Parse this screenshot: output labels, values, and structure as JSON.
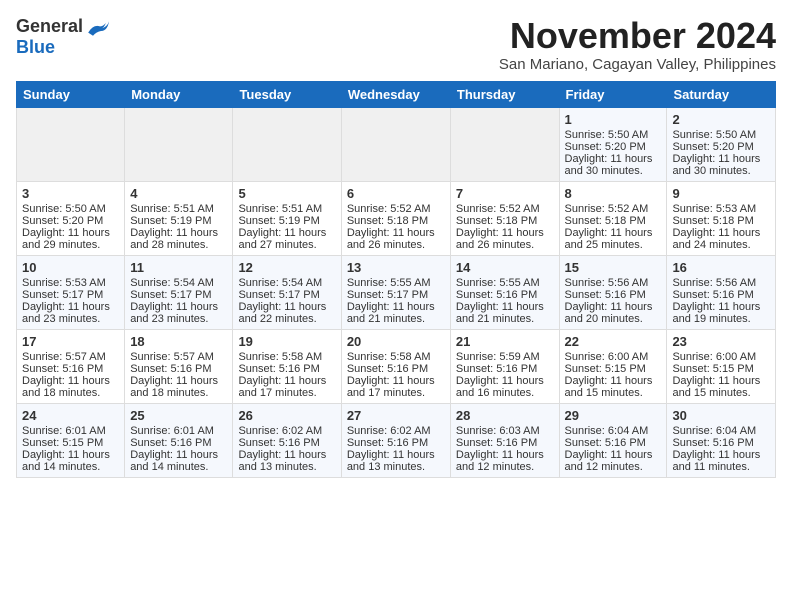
{
  "logo": {
    "general": "General",
    "blue": "Blue"
  },
  "title": "November 2024",
  "location": "San Mariano, Cagayan Valley, Philippines",
  "days_of_week": [
    "Sunday",
    "Monday",
    "Tuesday",
    "Wednesday",
    "Thursday",
    "Friday",
    "Saturday"
  ],
  "weeks": [
    [
      {
        "day": "",
        "info": "",
        "empty": true
      },
      {
        "day": "",
        "info": "",
        "empty": true
      },
      {
        "day": "",
        "info": "",
        "empty": true
      },
      {
        "day": "",
        "info": "",
        "empty": true
      },
      {
        "day": "",
        "info": "",
        "empty": true
      },
      {
        "day": "1",
        "sunrise": "Sunrise: 5:50 AM",
        "sunset": "Sunset: 5:20 PM",
        "daylight": "Daylight: 11 hours and 30 minutes."
      },
      {
        "day": "2",
        "sunrise": "Sunrise: 5:50 AM",
        "sunset": "Sunset: 5:20 PM",
        "daylight": "Daylight: 11 hours and 30 minutes."
      }
    ],
    [
      {
        "day": "3",
        "sunrise": "Sunrise: 5:50 AM",
        "sunset": "Sunset: 5:20 PM",
        "daylight": "Daylight: 11 hours and 29 minutes."
      },
      {
        "day": "4",
        "sunrise": "Sunrise: 5:51 AM",
        "sunset": "Sunset: 5:19 PM",
        "daylight": "Daylight: 11 hours and 28 minutes."
      },
      {
        "day": "5",
        "sunrise": "Sunrise: 5:51 AM",
        "sunset": "Sunset: 5:19 PM",
        "daylight": "Daylight: 11 hours and 27 minutes."
      },
      {
        "day": "6",
        "sunrise": "Sunrise: 5:52 AM",
        "sunset": "Sunset: 5:18 PM",
        "daylight": "Daylight: 11 hours and 26 minutes."
      },
      {
        "day": "7",
        "sunrise": "Sunrise: 5:52 AM",
        "sunset": "Sunset: 5:18 PM",
        "daylight": "Daylight: 11 hours and 26 minutes."
      },
      {
        "day": "8",
        "sunrise": "Sunrise: 5:52 AM",
        "sunset": "Sunset: 5:18 PM",
        "daylight": "Daylight: 11 hours and 25 minutes."
      },
      {
        "day": "9",
        "sunrise": "Sunrise: 5:53 AM",
        "sunset": "Sunset: 5:18 PM",
        "daylight": "Daylight: 11 hours and 24 minutes."
      }
    ],
    [
      {
        "day": "10",
        "sunrise": "Sunrise: 5:53 AM",
        "sunset": "Sunset: 5:17 PM",
        "daylight": "Daylight: 11 hours and 23 minutes."
      },
      {
        "day": "11",
        "sunrise": "Sunrise: 5:54 AM",
        "sunset": "Sunset: 5:17 PM",
        "daylight": "Daylight: 11 hours and 23 minutes."
      },
      {
        "day": "12",
        "sunrise": "Sunrise: 5:54 AM",
        "sunset": "Sunset: 5:17 PM",
        "daylight": "Daylight: 11 hours and 22 minutes."
      },
      {
        "day": "13",
        "sunrise": "Sunrise: 5:55 AM",
        "sunset": "Sunset: 5:17 PM",
        "daylight": "Daylight: 11 hours and 21 minutes."
      },
      {
        "day": "14",
        "sunrise": "Sunrise: 5:55 AM",
        "sunset": "Sunset: 5:16 PM",
        "daylight": "Daylight: 11 hours and 21 minutes."
      },
      {
        "day": "15",
        "sunrise": "Sunrise: 5:56 AM",
        "sunset": "Sunset: 5:16 PM",
        "daylight": "Daylight: 11 hours and 20 minutes."
      },
      {
        "day": "16",
        "sunrise": "Sunrise: 5:56 AM",
        "sunset": "Sunset: 5:16 PM",
        "daylight": "Daylight: 11 hours and 19 minutes."
      }
    ],
    [
      {
        "day": "17",
        "sunrise": "Sunrise: 5:57 AM",
        "sunset": "Sunset: 5:16 PM",
        "daylight": "Daylight: 11 hours and 18 minutes."
      },
      {
        "day": "18",
        "sunrise": "Sunrise: 5:57 AM",
        "sunset": "Sunset: 5:16 PM",
        "daylight": "Daylight: 11 hours and 18 minutes."
      },
      {
        "day": "19",
        "sunrise": "Sunrise: 5:58 AM",
        "sunset": "Sunset: 5:16 PM",
        "daylight": "Daylight: 11 hours and 17 minutes."
      },
      {
        "day": "20",
        "sunrise": "Sunrise: 5:58 AM",
        "sunset": "Sunset: 5:16 PM",
        "daylight": "Daylight: 11 hours and 17 minutes."
      },
      {
        "day": "21",
        "sunrise": "Sunrise: 5:59 AM",
        "sunset": "Sunset: 5:16 PM",
        "daylight": "Daylight: 11 hours and 16 minutes."
      },
      {
        "day": "22",
        "sunrise": "Sunrise: 6:00 AM",
        "sunset": "Sunset: 5:15 PM",
        "daylight": "Daylight: 11 hours and 15 minutes."
      },
      {
        "day": "23",
        "sunrise": "Sunrise: 6:00 AM",
        "sunset": "Sunset: 5:15 PM",
        "daylight": "Daylight: 11 hours and 15 minutes."
      }
    ],
    [
      {
        "day": "24",
        "sunrise": "Sunrise: 6:01 AM",
        "sunset": "Sunset: 5:15 PM",
        "daylight": "Daylight: 11 hours and 14 minutes."
      },
      {
        "day": "25",
        "sunrise": "Sunrise: 6:01 AM",
        "sunset": "Sunset: 5:16 PM",
        "daylight": "Daylight: 11 hours and 14 minutes."
      },
      {
        "day": "26",
        "sunrise": "Sunrise: 6:02 AM",
        "sunset": "Sunset: 5:16 PM",
        "daylight": "Daylight: 11 hours and 13 minutes."
      },
      {
        "day": "27",
        "sunrise": "Sunrise: 6:02 AM",
        "sunset": "Sunset: 5:16 PM",
        "daylight": "Daylight: 11 hours and 13 minutes."
      },
      {
        "day": "28",
        "sunrise": "Sunrise: 6:03 AM",
        "sunset": "Sunset: 5:16 PM",
        "daylight": "Daylight: 11 hours and 12 minutes."
      },
      {
        "day": "29",
        "sunrise": "Sunrise: 6:04 AM",
        "sunset": "Sunset: 5:16 PM",
        "daylight": "Daylight: 11 hours and 12 minutes."
      },
      {
        "day": "30",
        "sunrise": "Sunrise: 6:04 AM",
        "sunset": "Sunset: 5:16 PM",
        "daylight": "Daylight: 11 hours and 11 minutes."
      }
    ]
  ]
}
